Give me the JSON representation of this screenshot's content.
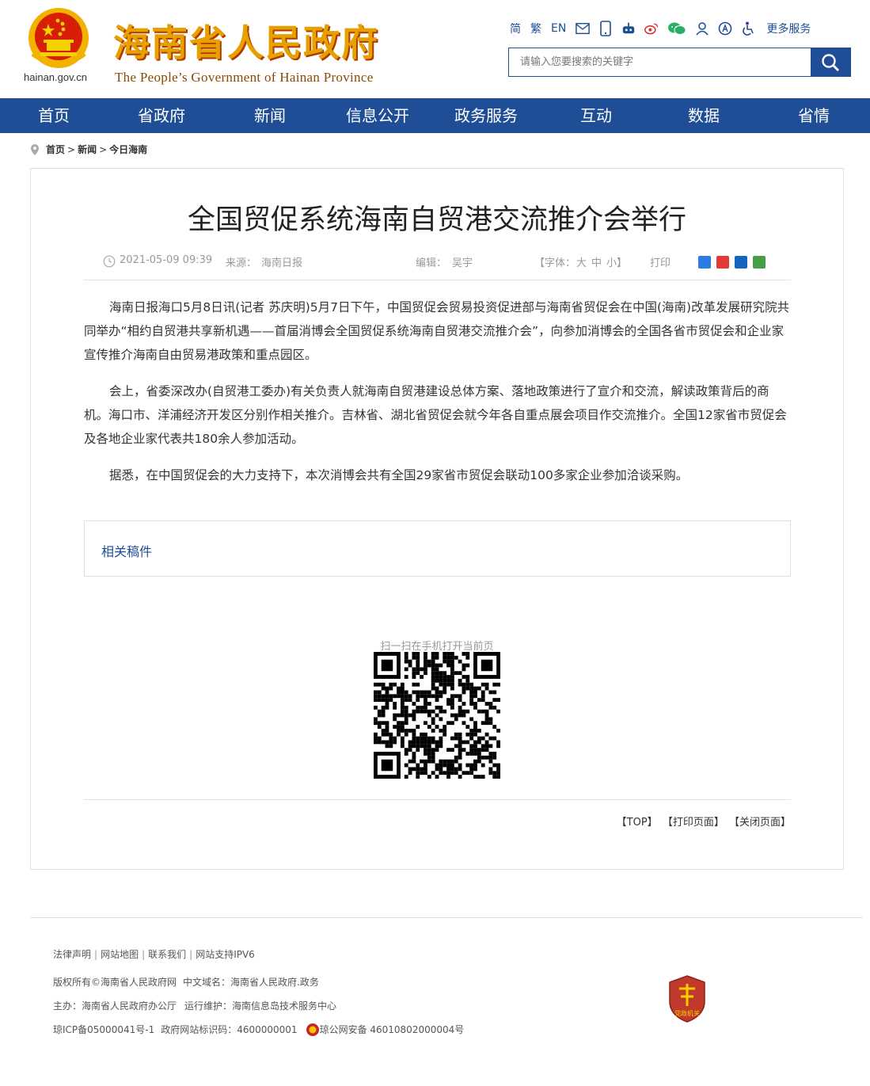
{
  "header": {
    "domain": "hainan.gov.cn",
    "title_cn": "海南省人民政府",
    "title_en": "The People’s Government  of Hainan Province",
    "lang_simplified": "简",
    "lang_traditional": "繁",
    "lang_english": "EN",
    "more_services": "更多服务",
    "search_placeholder": "请输入您要搜索的关键字"
  },
  "nav": {
    "items": [
      {
        "label": "首页"
      },
      {
        "label": "省政府"
      },
      {
        "label": "新闻"
      },
      {
        "label": "信息公开"
      },
      {
        "label": "政务服务"
      },
      {
        "label": "互动"
      },
      {
        "label": "数据"
      },
      {
        "label": "省情"
      }
    ]
  },
  "breadcrumb": {
    "home": "首页",
    "news": "新闻",
    "current": "今日海南"
  },
  "article": {
    "title": "全国贸促系统海南自贸港交流推介会举行",
    "datetime": "2021-05-09 09:39",
    "source_label": "来源：",
    "source": "海南日报",
    "editor_label": "编辑：",
    "editor": "吴宇",
    "font_label": "【字体：",
    "font_large": "大",
    "font_medium": "中",
    "font_small": "小】",
    "print": "打印",
    "paragraphs": [
      "海南日报海口5月8日讯(记者 苏庆明)5月7日下午，中国贸促会贸易投资促进部与海南省贸促会在中国(海南)改革发展研究院共同举办“相约自贸港共享新机遇——首届消博会全国贸促系统海南自贸港交流推介会”，向参加消博会的全国各省市贸促会和企业家宣传推介海南自由贸易港政策和重点园区。",
      "会上，省委深改办(自贸港工委办)有关负责人就海南自贸港建设总体方案、落地政策进行了宣介和交流，解读政策背后的商机。海口市、洋浦经济开发区分别作相关推介。吉林省、湖北省贸促会就今年各自重点展会项目作交流推介。全国12家省市贸促会及各地企业家代表共180余人参加活动。",
      "据悉，在中国贸促会的大力支持下，本次消博会共有全国29家省市贸促会联动100多家企业参加洽谈采购。"
    ],
    "related": "相关稿件",
    "qr_label": "扫一扫在手机打开当前页",
    "top_link": "【TOP】",
    "print_page": "【打印页面】",
    "close_page": "【关闭页面】"
  },
  "footer": {
    "legal": "法律声明",
    "sitemap": "网站地图",
    "contact": "联系我们",
    "ipv6": "网站支持IPV6",
    "copyright": "版权所有©海南省人民政府网",
    "cn_domain": "中文域名：海南省人民政府.政务",
    "sponsor": "主办：海南省人民政府办公厅",
    "maintain": "运行维护：海南信息岛技术服务中心",
    "icp": "琼ICP备05000041号-1",
    "site_code": "政府网站标识码：4600000001",
    "police": "琼公网安备 46010802000004号",
    "badge_text": "党政机关"
  },
  "colors": {
    "brand_blue": "#1f4e96",
    "title_gold": "#e6a100",
    "badge_red": "#c0392b"
  }
}
